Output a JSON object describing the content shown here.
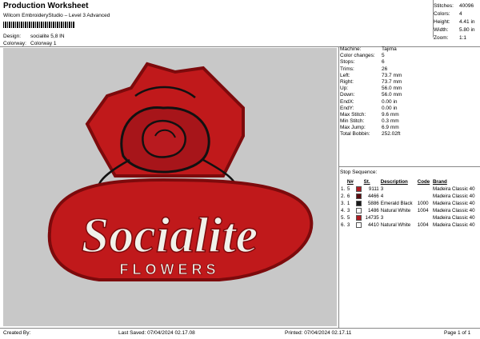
{
  "header": {
    "title": "Production Worksheet",
    "software": "Wilcom EmbroideryStudio – Level 3 Advanced",
    "design_label": "Design:",
    "design_value": "socialite 5,8 IN",
    "colorway_label": "Colorway:",
    "colorway_value": "Colorway 1"
  },
  "summary": {
    "stitches_label": "Stitches:",
    "stitches": "40096",
    "colors_label": "Colors:",
    "colors": "4",
    "height_label": "Height:",
    "height": "4.41 in",
    "width_label": "Width:",
    "width": "5.80 in",
    "zoom_label": "Zoom:",
    "zoom": "1:1"
  },
  "artwork": {
    "main_text": "Socialite",
    "sub_text": "FLOWERS",
    "colors": {
      "background": "#c8c8c8",
      "red": "#c0191b",
      "dark_red": "#7d0a0c",
      "white": "#f1f1ea",
      "black": "#111111"
    }
  },
  "properties": [
    {
      "k": "Machine:",
      "v": "Tajima"
    },
    {
      "k": "Color changes:",
      "v": "5"
    },
    {
      "k": "Stops:",
      "v": "6"
    },
    {
      "k": "Trims:",
      "v": "26"
    },
    {
      "k": "Left:",
      "v": "73.7 mm"
    },
    {
      "k": "Right:",
      "v": "73.7 mm"
    },
    {
      "k": "Up:",
      "v": "56.0 mm"
    },
    {
      "k": "Down:",
      "v": "56.0 mm"
    },
    {
      "k": "EndX:",
      "v": "0.00 in"
    },
    {
      "k": "EndY:",
      "v": "0.00 in"
    },
    {
      "k": "Max Stitch:",
      "v": "9.6 mm"
    },
    {
      "k": "Min Stitch:",
      "v": "0.3 mm"
    },
    {
      "k": "Max Jump:",
      "v": "6.9 mm"
    },
    {
      "k": "Total Bobbin:",
      "v": "252.02ft"
    }
  ],
  "stop_sequence": {
    "title": "Stop Sequence:",
    "headers": [
      "N#",
      "St.",
      "Description",
      "Code",
      "Brand"
    ],
    "rows": [
      {
        "idx": "1.",
        "n": "5",
        "color": "#b01c22",
        "st": "9111",
        "desc": "3",
        "code": "",
        "brand": "Madeira Classic 40"
      },
      {
        "idx": "2.",
        "n": "6",
        "color": "#5a0d10",
        "st": "4466",
        "desc": "4",
        "code": "",
        "brand": "Madeira Classic 40"
      },
      {
        "idx": "3.",
        "n": "1",
        "color": "#1a1a1a",
        "st": "5886",
        "desc": "Emerald Black",
        "code": "1000",
        "brand": "Madeira Classic 40"
      },
      {
        "idx": "4.",
        "n": "3",
        "color": "#ffffff",
        "st": "1486",
        "desc": "Natural White",
        "code": "1004",
        "brand": "Madeira Classic 40"
      },
      {
        "idx": "5.",
        "n": "5",
        "color": "#b01c22",
        "st": "14735",
        "desc": "3",
        "code": "",
        "brand": "Madeira Classic 40"
      },
      {
        "idx": "6.",
        "n": "3",
        "color": "#ffffff",
        "st": "4410",
        "desc": "Natural White",
        "code": "1004",
        "brand": "Madeira Classic 40"
      }
    ]
  },
  "footer": {
    "created_by": "Created By:",
    "last_saved": "Last Saved: 07/04/2024 02.17.08",
    "printed": "Printed: 07/04/2024 02.17.11",
    "page": "Page 1 of 1"
  }
}
